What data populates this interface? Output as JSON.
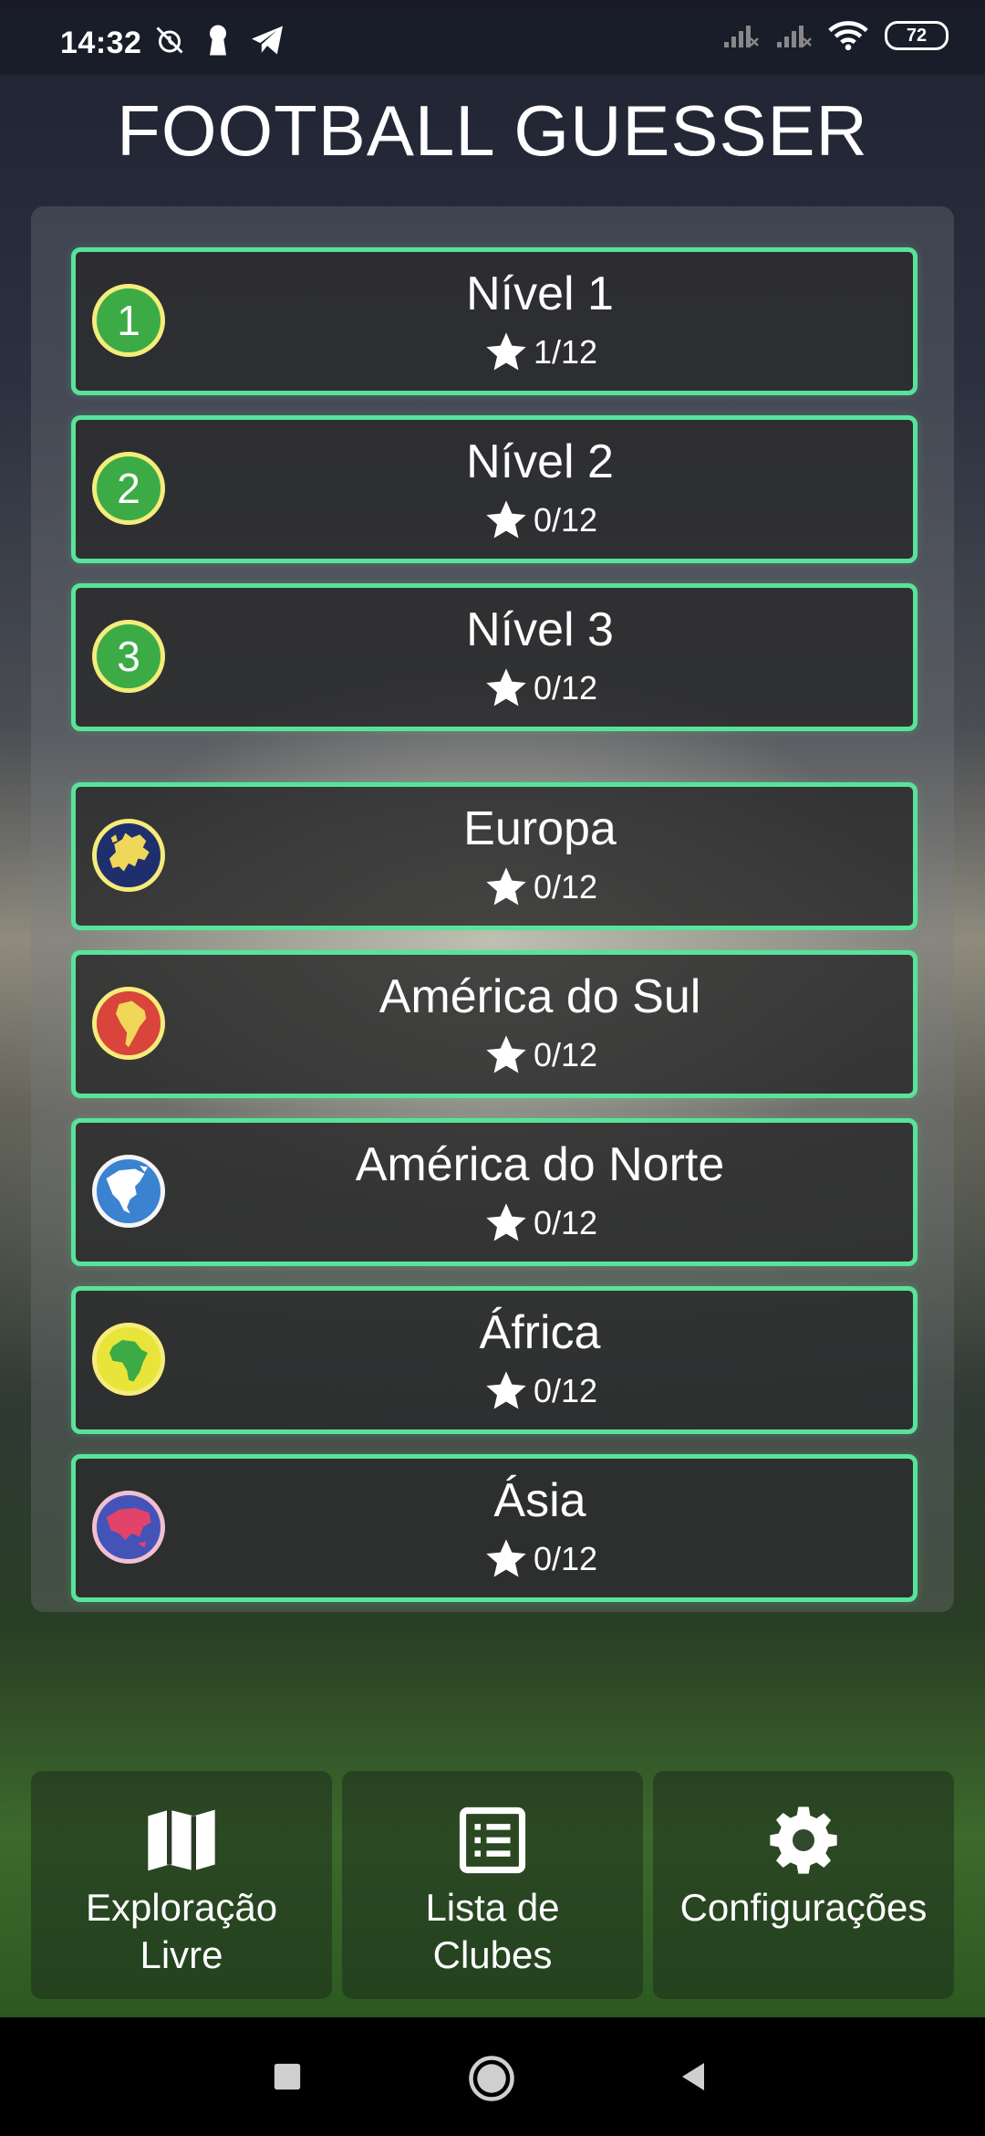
{
  "status": {
    "time": "14:32",
    "battery": "72"
  },
  "app": {
    "title": "FOOTBALL GUESSER"
  },
  "levels": [
    {
      "badge": "1",
      "title": "Nível 1",
      "progress": "1/12"
    },
    {
      "badge": "2",
      "title": "Nível 2",
      "progress": "0/12"
    },
    {
      "badge": "3",
      "title": "Nível 3",
      "progress": "0/12"
    }
  ],
  "continents": [
    {
      "icon": "europe-map-icon",
      "title": "Europa",
      "progress": "0/12",
      "color": "#1f2f6e"
    },
    {
      "icon": "south-america-map-icon",
      "title": "América do Sul",
      "progress": "0/12",
      "color": "#d9443b"
    },
    {
      "icon": "north-america-map-icon",
      "title": "América do Norte",
      "progress": "0/12",
      "color": "#3b82d1"
    },
    {
      "icon": "africa-map-icon",
      "title": "África",
      "progress": "0/12",
      "color": "#e8e43a"
    },
    {
      "icon": "asia-map-icon",
      "title": "Ásia",
      "progress": "0/12",
      "color": "#4453b8"
    }
  ],
  "bottom_nav": {
    "explore": "Exploração\nLivre",
    "clubs": "Lista de\nClubes",
    "settings": "Configurações"
  },
  "colors": {
    "accent": "#59e39a",
    "badge_green": "#3cab46",
    "badge_ring": "#f5ec7a"
  }
}
